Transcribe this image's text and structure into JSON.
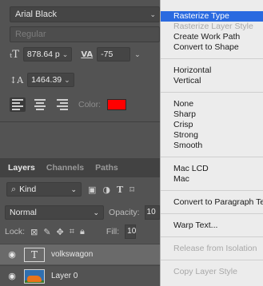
{
  "character_panel": {
    "font_family": "Arial Black",
    "font_style": "Regular",
    "font_size": "878.64 p",
    "tracking_icon_label": "VA",
    "tracking": "-75",
    "leading": "1464.39",
    "color_label": "Color:",
    "color": "#ff0000"
  },
  "layers_panel": {
    "tabs": [
      "Layers",
      "Channels",
      "Paths"
    ],
    "filter_kind": "Kind",
    "blend_mode": "Normal",
    "opacity_label": "Opacity:",
    "opacity_value": "10",
    "lock_label": "Lock:",
    "fill_label": "Fill:",
    "fill_value": "10",
    "layers": [
      {
        "name": "volkswagon",
        "type": "text",
        "selected": true
      },
      {
        "name": "Layer 0",
        "type": "image",
        "selected": false
      }
    ]
  },
  "context_menu": {
    "groups": [
      [
        {
          "label": "Rasterize Type",
          "state": "highlighted"
        },
        {
          "label": "Rasterize Layer Style",
          "state": "disabled"
        },
        {
          "label": "Create Work Path",
          "state": "normal"
        },
        {
          "label": "Convert to Shape",
          "state": "normal"
        }
      ],
      [
        {
          "label": "Horizontal",
          "state": "normal"
        },
        {
          "label": "Vertical",
          "state": "normal"
        }
      ],
      [
        {
          "label": "None",
          "state": "normal"
        },
        {
          "label": "Sharp",
          "state": "normal"
        },
        {
          "label": "Crisp",
          "state": "normal"
        },
        {
          "label": "Strong",
          "state": "normal"
        },
        {
          "label": "Smooth",
          "state": "normal"
        }
      ],
      [
        {
          "label": "Mac LCD",
          "state": "normal"
        },
        {
          "label": "Mac",
          "state": "normal"
        }
      ],
      [
        {
          "label": "Convert to Paragraph Text",
          "state": "normal"
        }
      ],
      [
        {
          "label": "Warp Text...",
          "state": "normal"
        }
      ],
      [
        {
          "label": "Release from Isolation",
          "state": "disabled"
        }
      ],
      [
        {
          "label": "Copy Layer Style",
          "state": "disabled"
        }
      ]
    ]
  },
  "colors": {
    "panel_bg": "#535353",
    "menu_bg": "#ececec",
    "menu_highlight": "#2a6ae0",
    "selected_layer": "#6a6a6a"
  }
}
